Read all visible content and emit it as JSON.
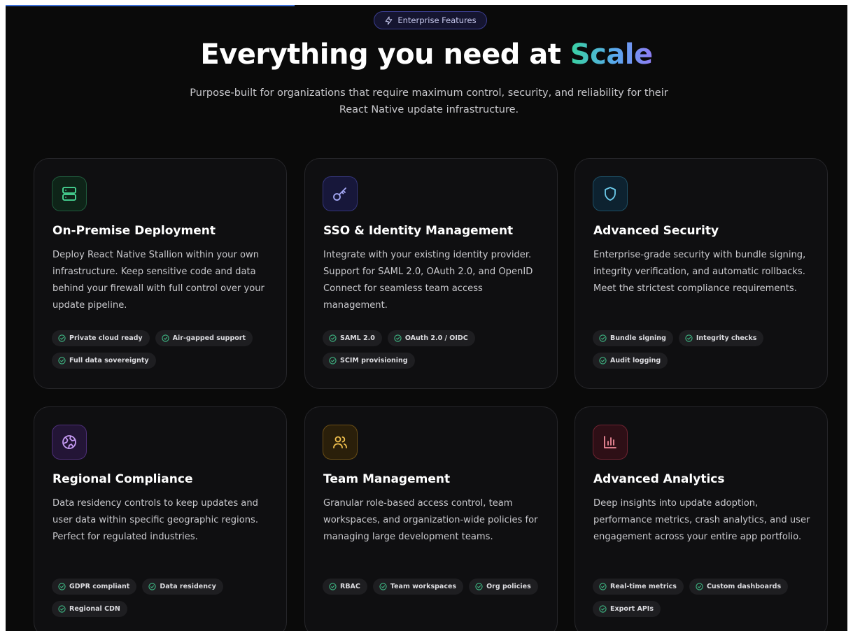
{
  "badge": {
    "icon": "lightning-icon",
    "label": "Enterprise Features"
  },
  "hero": {
    "title_main": "Everything you need at ",
    "title_accent": "Scale",
    "subtitle": "Purpose-built for organizations that require maximum control, security, and reliability for their React Native update infrastructure."
  },
  "colors": {
    "background": "#0a0a0a",
    "card": "#0f0f11",
    "check": "#3fb985",
    "accent_gradient": [
      "#39d1a0",
      "#5aa8f0",
      "#8f7cf3"
    ]
  },
  "cards": [
    {
      "icon": "server-icon",
      "icon_color": "#4ade9a",
      "title": "On-Premise Deployment",
      "description": "Deploy React Native Stallion within your own infrastructure. Keep sensitive code and data behind your firewall with full control over your update pipeline.",
      "tags": [
        "Private cloud ready",
        "Air-gapped support",
        "Full data sovereignty"
      ]
    },
    {
      "icon": "key-icon",
      "icon_color": "#a5a8f5",
      "title": "SSO & Identity Management",
      "description": "Integrate with your existing identity provider. Support for SAML 2.0, OAuth 2.0, and OpenID Connect for seamless team access management.",
      "tags": [
        "SAML 2.0",
        "OAuth 2.0 / OIDC",
        "SCIM provisioning"
      ]
    },
    {
      "icon": "shield-icon",
      "icon_color": "#6ccbeb",
      "title": "Advanced Security",
      "description": "Enterprise-grade security with bundle signing, integrity verification, and automatic rollbacks. Meet the strictest compliance requirements.",
      "tags": [
        "Bundle signing",
        "Integrity checks",
        "Audit logging"
      ]
    },
    {
      "icon": "globe-icon",
      "icon_color": "#c69bf4",
      "title": "Regional Compliance",
      "description": "Data residency controls to keep updates and user data within specific geographic regions. Perfect for regulated industries.",
      "tags": [
        "GDPR compliant",
        "Data residency",
        "Regional CDN"
      ]
    },
    {
      "icon": "users-icon",
      "icon_color": "#f2c14e",
      "title": "Team Management",
      "description": "Granular role-based access control, team workspaces, and organization-wide policies for managing large development teams.",
      "tags": [
        "RBAC",
        "Team workspaces",
        "Org policies"
      ]
    },
    {
      "icon": "bar-chart-icon",
      "icon_color": "#f08a9a",
      "title": "Advanced Analytics",
      "description": "Deep insights into update adoption, performance metrics, crash analytics, and user engagement across your entire app portfolio.",
      "tags": [
        "Real-time metrics",
        "Custom dashboards",
        "Export APIs"
      ]
    }
  ]
}
